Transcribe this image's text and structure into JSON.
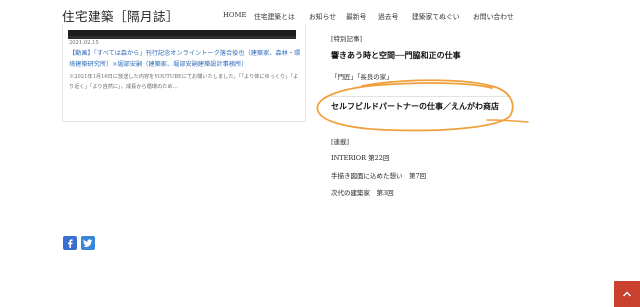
{
  "site": {
    "title": "住宅建築［隔月誌］"
  },
  "nav": {
    "items": [
      {
        "label": "HOME",
        "name": "nav-item-home"
      },
      {
        "label": "住宅建築とは",
        "name": "nav-item-about"
      },
      {
        "label": "お知らせ",
        "name": "nav-item-news"
      },
      {
        "label": "最新号",
        "name": "nav-item-latest-issue"
      },
      {
        "label": "過去号",
        "name": "nav-item-back-issues"
      },
      {
        "label": "建築家てぬぐい",
        "name": "nav-item-tenugui"
      },
      {
        "label": "お問い合わせ",
        "name": "nav-item-contact"
      }
    ]
  },
  "post": {
    "date": "2021.02.15",
    "title": "【動画】「すべては森から」刊行記念オンライントーク落合俊也（建築家、森林・環境建築研究所）×堀部安嗣（建築家、堀部安嗣建築設計事務所）",
    "excerpt": "※2021年1月16日に放送した内容をYOUTUBEにてお聞いたしました。「「より体にゆっくり」「より近く」「より自然に」。成長から循環のため…"
  },
  "contents": {
    "special_label": "[特別記事]",
    "special_title": "響きあう時と空間──門脇和正の仕事",
    "special_subs": "「門匠」「長良の家」",
    "feature_title": "セルフビルドパートナーの仕事／えんがわ商店",
    "serial_label": "[連載]",
    "serials": [
      "INTERIOR 第22回",
      "手描き図面に込めた想い　第7回",
      "次代の建築家　第3回"
    ]
  },
  "social": {
    "facebook_icon": "facebook-icon",
    "twitter_icon": "twitter-icon"
  },
  "colors": {
    "link": "#2f6dbb",
    "annotation": "#f0a03c",
    "back_to_top": "#c9412e"
  }
}
